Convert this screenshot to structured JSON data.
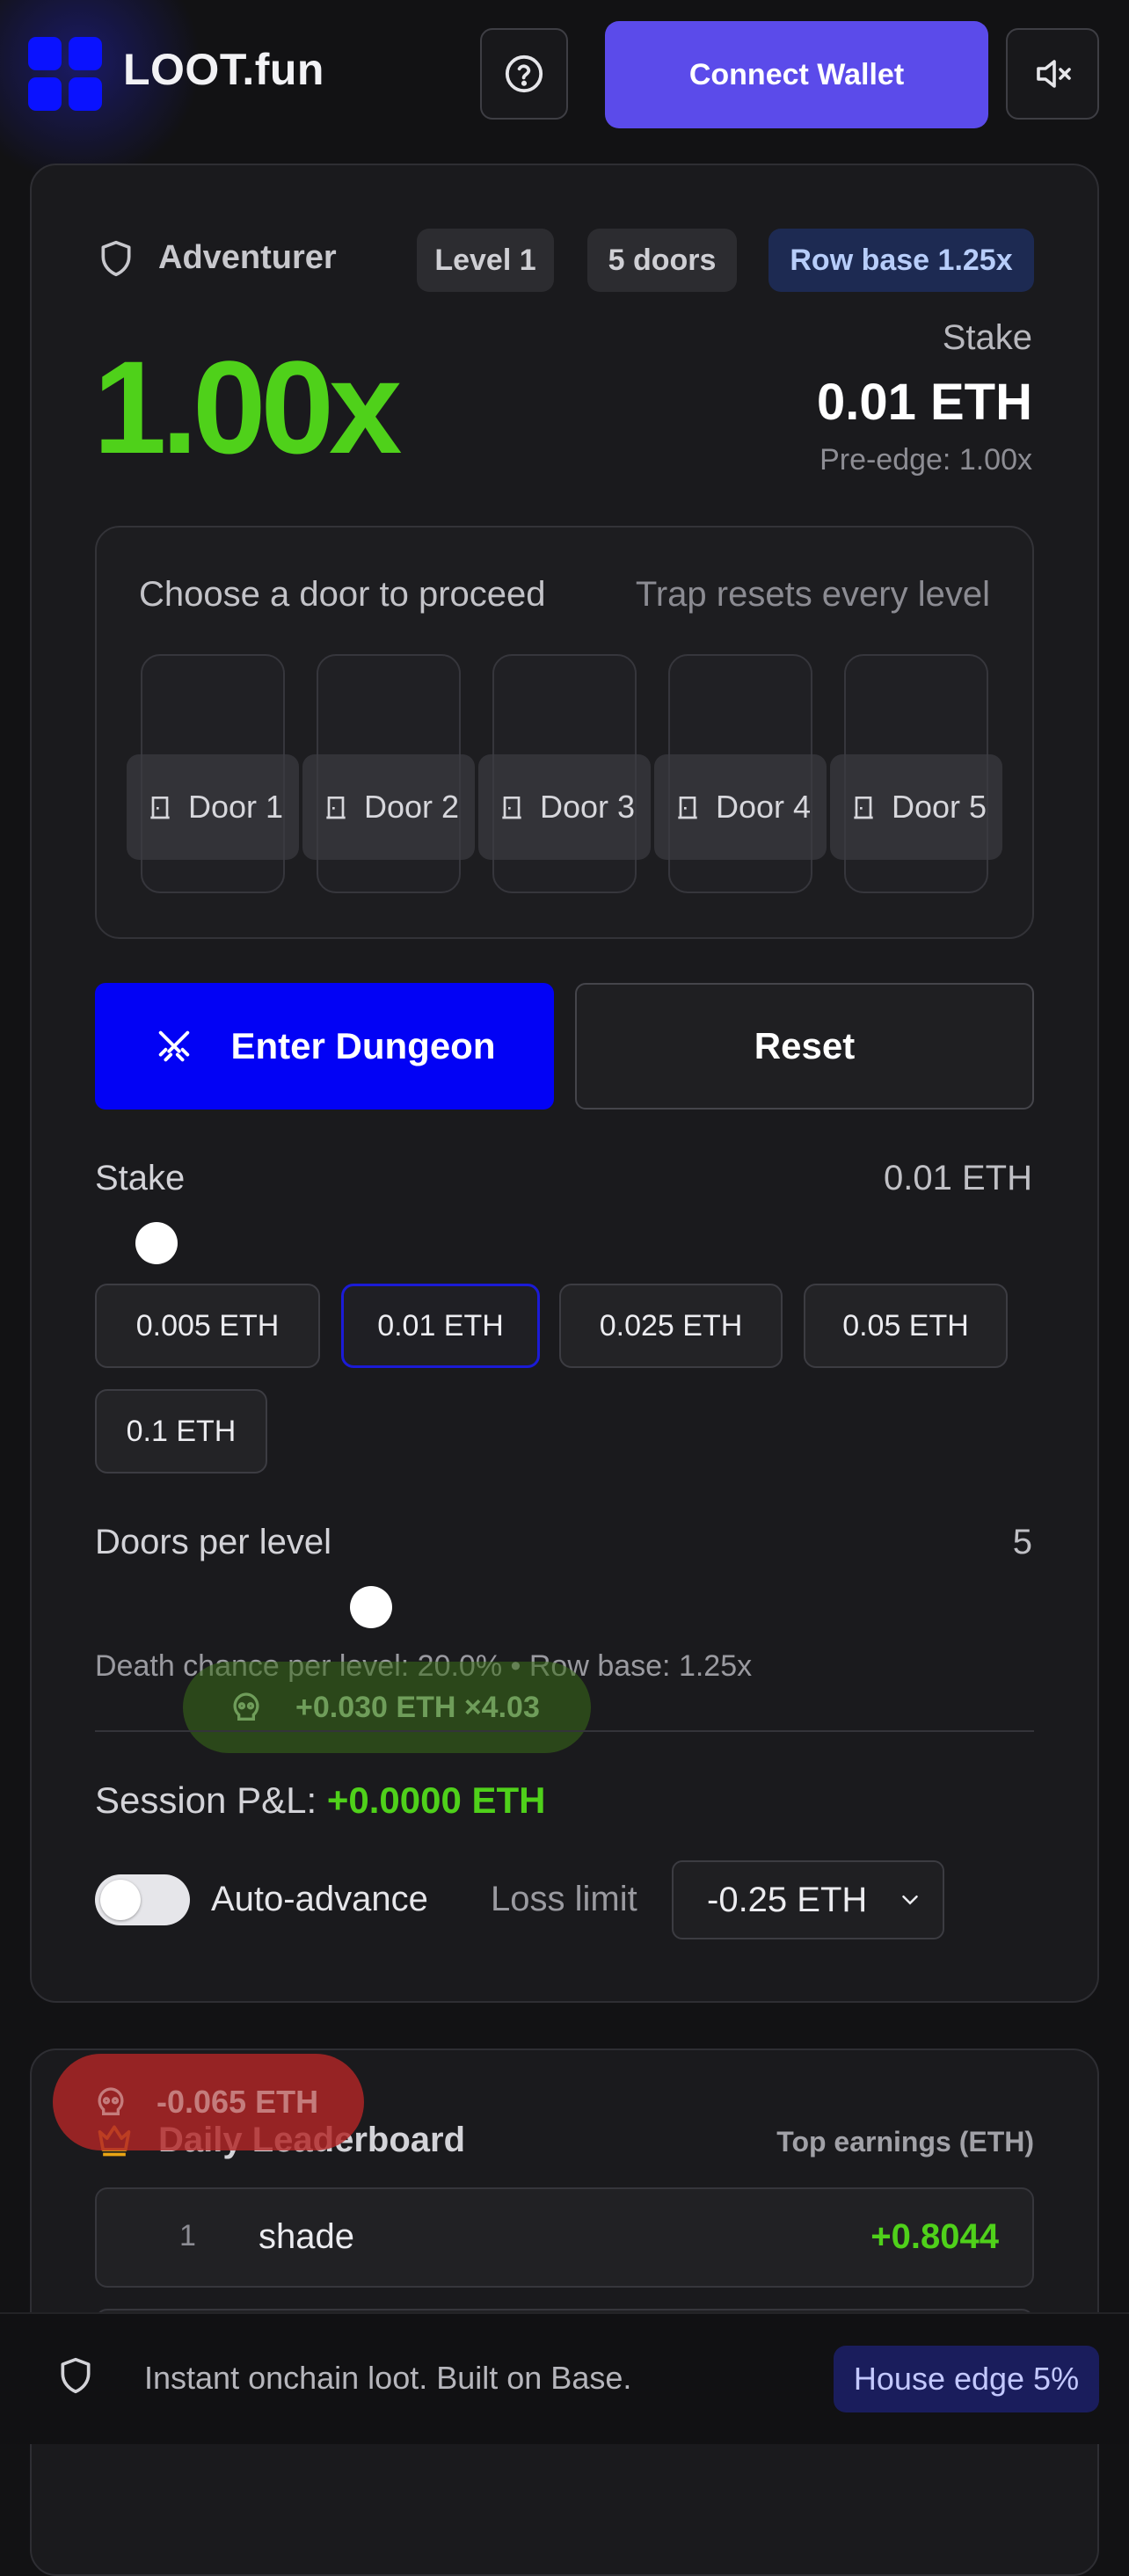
{
  "header": {
    "brand": "LOOT.fun",
    "connect_label": "Connect Wallet",
    "help_icon": "question-circle-icon",
    "mute_icon": "volume-muted-icon"
  },
  "game": {
    "role": "Adventurer",
    "level_pill": "Level 1",
    "doors_pill": "5 doors",
    "row_base_pill": "Row base 1.25x",
    "multiplier": "1.00x",
    "stake_label": "Stake",
    "stake_value": "0.01 ETH",
    "pre_edge": "Pre-edge: 1.00x",
    "door_hint": "Choose a door to proceed",
    "door_note": "Trap resets every level",
    "doors": [
      {
        "label": "Door 1"
      },
      {
        "label": "Door 2"
      },
      {
        "label": "Door 3"
      },
      {
        "label": "Door 4"
      },
      {
        "label": "Door 5"
      }
    ],
    "enter_label": "Enter Dungeon",
    "reset_label": "Reset"
  },
  "stake": {
    "label": "Stake",
    "value": "0.01 ETH",
    "slider_fraction": 0.05,
    "chips": [
      "0.005 ETH",
      "0.01 ETH",
      "0.025 ETH",
      "0.05 ETH",
      "0.1 ETH"
    ],
    "selected": "0.01 ETH"
  },
  "doors_per_level": {
    "label": "Doors per level",
    "value": "5",
    "death_info": "Death chance per level: 20.0% • Row base: 1.25x"
  },
  "float_win": "+0.030 ETH ×4.03",
  "session": {
    "label": "Session P&L:",
    "value": "+0.0000 ETH",
    "auto_advance_label": "Auto-advance",
    "auto_advance_on": false,
    "loss_limit_label": "Loss limit",
    "loss_limit_value": "-0.25 ETH"
  },
  "leaderboard": {
    "title": "Daily Leaderboard",
    "subtitle": "Top earnings (ETH)",
    "float_loss": "-0.065 ETH",
    "rows": [
      {
        "rank": "1",
        "name": "shade",
        "score": "+0.8044"
      }
    ]
  },
  "footer": {
    "message": "Instant onchain loot. Built on Base.",
    "house_edge": "House edge 5%"
  },
  "colors": {
    "accent_blue": "#0202f5",
    "connect_purple": "#5b4bea",
    "win_green": "#4fd11a",
    "background": "#121214"
  }
}
